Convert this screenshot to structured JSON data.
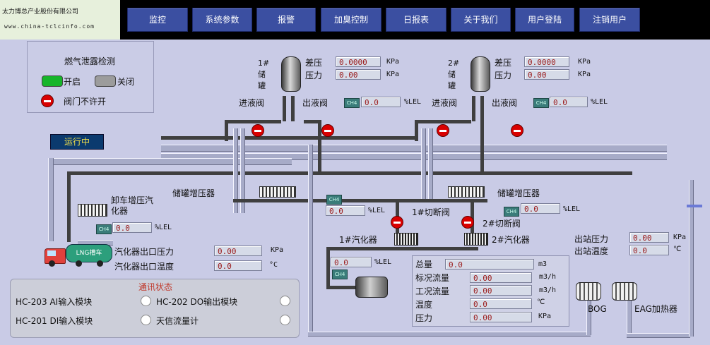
{
  "header": {
    "company": "太力博总产业股份有限公司",
    "website": "www.china-tclcinfo.com",
    "nav": [
      "监控",
      "系统参数",
      "报警",
      "加臭控制",
      "日报表",
      "关于我们",
      "用户登陆",
      "注销用户"
    ]
  },
  "legend": {
    "title": "燃气泄露检测",
    "open": "开启",
    "closed": "关闭",
    "no_open": "阀门不许开"
  },
  "status": {
    "running": "运行中"
  },
  "tank1": {
    "name": "1#储罐",
    "diff_label": "差压",
    "diff_value": "0.0000",
    "diff_unit": "KPa",
    "press_label": "压力",
    "press_value": "0.00",
    "press_unit": "KPa",
    "inlet": "进液阀",
    "outlet": "出液阀",
    "lel_value": "0.0",
    "lel_unit": "%LEL"
  },
  "tank2": {
    "name": "2#储罐",
    "diff_label": "差压",
    "diff_value": "0.0000",
    "diff_unit": "KPa",
    "press_label": "压力",
    "press_value": "0.00",
    "press_unit": "KPa",
    "inlet": "进液阀",
    "outlet": "出液阀",
    "lel_value": "0.0",
    "lel_unit": "%LEL"
  },
  "pressurizer": {
    "left": "储罐增压器",
    "right": "储罐增压器"
  },
  "unload": {
    "label": "卸车增压汽化器",
    "lel_value": "0.0",
    "lel_unit": "%LEL"
  },
  "cutoff": {
    "v1": "1#切断阀",
    "v2": "2#切断阀",
    "lel1_value": "0.0",
    "lel2_value": "0.0",
    "lel_unit": "%LEL"
  },
  "vaporizer": {
    "v1": "1#汽化器",
    "v2": "2#汽化器"
  },
  "truck": {
    "label": "LNG槽车"
  },
  "vaporizer_outlet": {
    "press_label": "汽化器出口压力",
    "press_value": "0.00",
    "press_unit": "KPa",
    "temp_label": "汽化器出口温度",
    "temp_value": "0.0",
    "temp_unit": "°C"
  },
  "station_out": {
    "press_label": "出站压力",
    "press_value": "0.00",
    "press_unit": "KPa",
    "temp_label": "出站温度",
    "temp_value": "0.0",
    "temp_unit": "℃"
  },
  "odor": {
    "lel_value": "0.0",
    "lel_unit": "%LEL"
  },
  "flow": {
    "total_label": "总量",
    "total_value": "0.0",
    "total_unit": "m3",
    "std_label": "标况流量",
    "std_value": "0.00",
    "std_unit": "m3/h",
    "work_label": "工况流量",
    "work_value": "0.00",
    "work_unit": "m3/h",
    "temp_label": "温度",
    "temp_value": "0.0",
    "temp_unit": "℃",
    "press_label": "压力",
    "press_value": "0.00",
    "press_unit": "KPa"
  },
  "heaters": {
    "bog": "BOG",
    "eag": "EAG加热器"
  },
  "comm": {
    "title": "通讯状态",
    "m1": "HC-203 AI输入模块",
    "m2": "HC-202 DO输出模块",
    "m3": "HC-201 DI输入模块",
    "m4": "天信流量计"
  },
  "colors": {
    "open": "#17b52a",
    "closed": "#9c9c9c",
    "alarm": "#d90000",
    "nav_bg": "#3b4fa1"
  }
}
